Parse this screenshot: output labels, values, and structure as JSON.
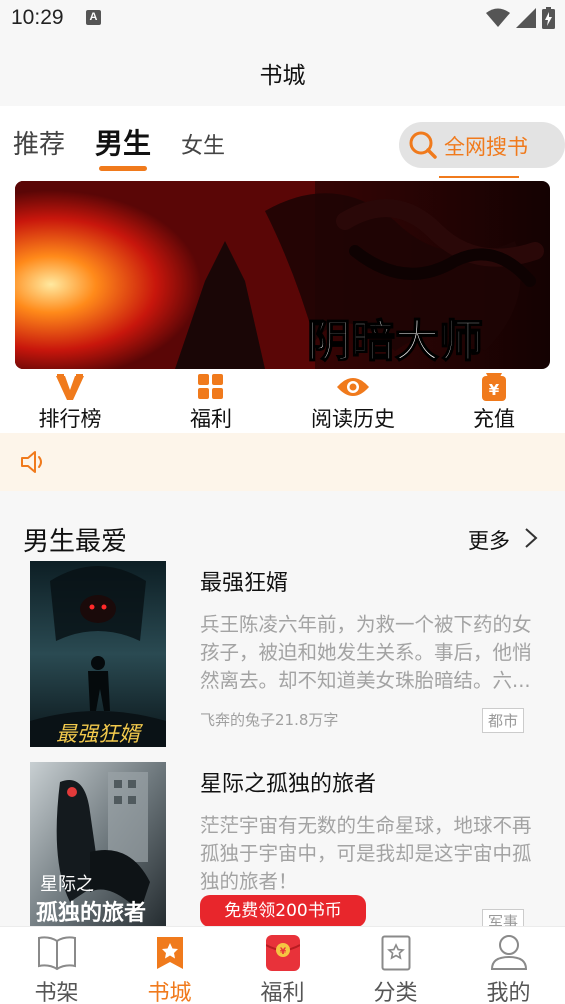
{
  "status_bar": {
    "time": "10:29",
    "notification_letter": "A"
  },
  "header": {
    "title": "书城"
  },
  "tabs": [
    {
      "label": "推荐"
    },
    {
      "label": "男生"
    },
    {
      "label": "女生"
    }
  ],
  "search": {
    "label": "全网搜书"
  },
  "banner": {
    "title_art": "阴暗大师"
  },
  "quick_nav": [
    {
      "label": "排行榜",
      "icon": "v-rank-icon"
    },
    {
      "label": "福利",
      "icon": "grid-icon"
    },
    {
      "label": "阅读历史",
      "icon": "eye-icon"
    },
    {
      "label": "充值",
      "icon": "yuan-icon"
    }
  ],
  "section": {
    "title": "男生最爱",
    "more": "更多",
    "books": [
      {
        "title": "最强狂婿",
        "description": "兵王陈凌六年前，为救一个被下药的女孩子，被迫和她发生关系。事后，他悄然离去。却不知道美女珠胎暗结。六...",
        "author_words": "飞奔的兔子21.8万字",
        "tag": "都市",
        "cover_text": "最强狂婿"
      },
      {
        "title": "星际之孤独的旅者",
        "description": "茫茫宇宙有无数的生命星球，地球不再孤独于宇宙中，可是我却是这宇宙中孤独的旅者！",
        "author_words": "",
        "tag": "军事",
        "cover_text_1": "星际之",
        "cover_text_2": "孤独的旅者"
      }
    ]
  },
  "promo": {
    "label": "免费领200书币"
  },
  "bottom_nav": [
    {
      "label": "书架"
    },
    {
      "label": "书城"
    },
    {
      "label": "福利"
    },
    {
      "label": "分类"
    },
    {
      "label": "我的"
    }
  ],
  "colors": {
    "accent": "#f07a1c",
    "promo_red": "#e8262c",
    "notice_bg": "#fdf5ea"
  }
}
